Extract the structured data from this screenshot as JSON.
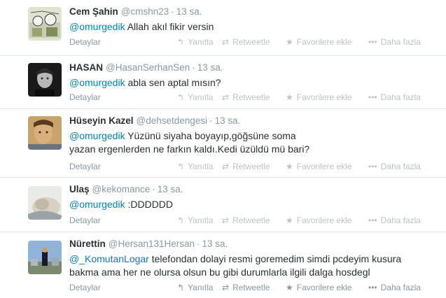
{
  "actions": {
    "details": "Detaylar",
    "reply": "Yanıtla",
    "retweet": "Retweetle",
    "favorite": "Favorilere ekle",
    "more": "Daha fazla",
    "icons": {
      "reply": "reply-icon",
      "retweet": "retweet-icon",
      "favorite": "star-icon",
      "more": "more-dots-icon"
    }
  },
  "colors": {
    "link": "#0084b4",
    "muted": "#8899a6",
    "divider": "#e1e8ed"
  },
  "tweets": [
    {
      "fullname": "Cem Şahin",
      "username": "@cmshn23",
      "time": "13 sa.",
      "mention": "@omurgedik",
      "text": " Allah akıl fikir versin"
    },
    {
      "fullname": "HASAN",
      "username": "@HasanSerhanSen",
      "time": "13 sa.",
      "mention": "@omurgedik",
      "text": " abla sen aptal mısın?"
    },
    {
      "fullname": "Hüseyin Kazel",
      "username": "@dehsetdengesi",
      "time": "13 sa.",
      "mention": "@omurgedik",
      "text": " Yüzünü siyaha boyayıp,göğsüne soma yazan ergenlerden ne farkın kaldı.Kedi üzüldü mü bari?"
    },
    {
      "fullname": "Ulaş",
      "username": "@kekomance",
      "time": "13 sa.",
      "mention": "@omurgedik",
      "text": " :DDDDDD"
    },
    {
      "fullname": "Nürettin",
      "username": "@Hersan131Hersan",
      "time": "13 sa.",
      "mention": "@_KomutanLogar",
      "text": " telefondan dolayi resmi goremedim simdi pcdeyim kusura bakma ama her ne olursa olsun bu gibi durumlarla ilgili dalga hosdegl"
    }
  ]
}
